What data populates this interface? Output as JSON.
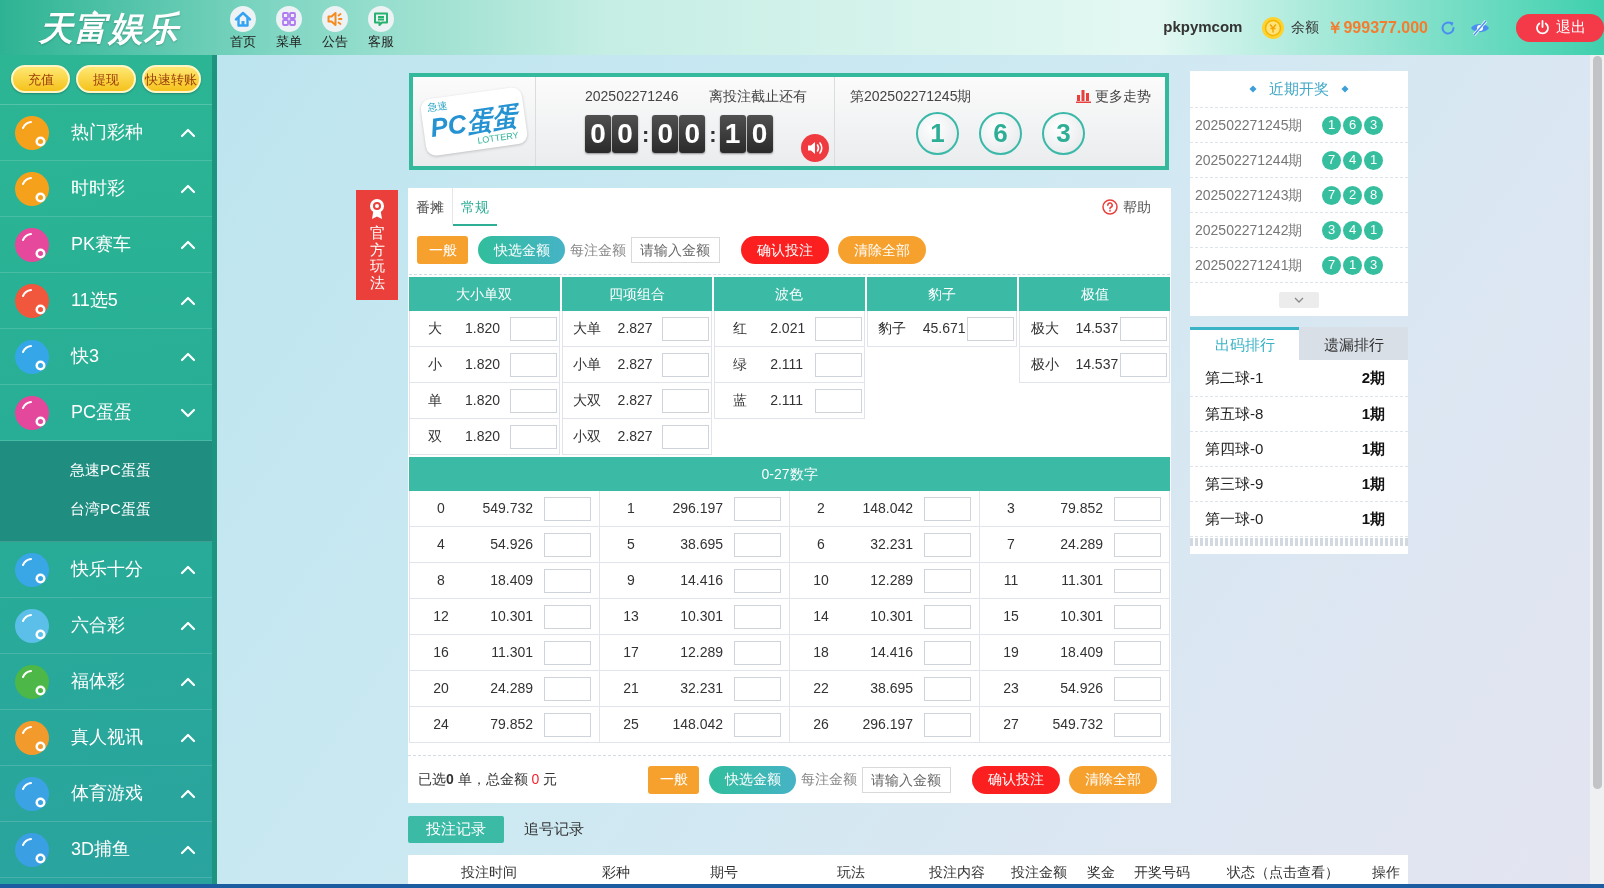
{
  "header": {
    "logo": "天富娱乐",
    "nav": [
      {
        "kind": "home",
        "label": "首页"
      },
      {
        "kind": "menu",
        "label": "菜单"
      },
      {
        "kind": "notice",
        "label": "公告"
      },
      {
        "kind": "service",
        "label": "客服"
      }
    ],
    "username": "pkpymcom",
    "balance_label": "余额",
    "balance": "￥999377.000",
    "logout": "退出"
  },
  "sidebar": {
    "actions": [
      "充值",
      "提现",
      "快速转账"
    ],
    "items": [
      {
        "label": "热门彩种",
        "color": "#f6a11c",
        "expanded": false
      },
      {
        "label": "时时彩",
        "color": "#f6a11c",
        "expanded": false
      },
      {
        "label": "PK赛车",
        "color": "#e6489b",
        "expanded": false
      },
      {
        "label": "11选5",
        "color": "#f0573c",
        "expanded": false
      },
      {
        "label": "快3",
        "color": "#35a7e8",
        "expanded": false
      },
      {
        "label": "PC蛋蛋",
        "color": "#e3489c",
        "expanded": true,
        "children": [
          {
            "label": "急速PC蛋蛋"
          },
          {
            "label": "台湾PC蛋蛋"
          }
        ]
      },
      {
        "label": "快乐十分",
        "color": "#39a6e6",
        "expanded": false
      },
      {
        "label": "六合彩",
        "color": "#5bbfe9",
        "expanded": false
      },
      {
        "label": "福体彩",
        "color": "#4db847",
        "expanded": false
      },
      {
        "label": "真人视讯",
        "color": "#f39a2c",
        "expanded": false
      },
      {
        "label": "体育游戏",
        "color": "#3ba2e4",
        "expanded": false
      },
      {
        "label": "3D捕鱼",
        "color": "#3aa0e3",
        "expanded": false
      }
    ]
  },
  "official_tab": "官方玩法",
  "draw_header": {
    "logo": {
      "badge": "急速",
      "title": "PC蛋蛋",
      "caption": "LOTTERY"
    },
    "current_issue": "202502271246",
    "countdown_label": "离投注截止还有",
    "countdown": [
      {
        "kind": "digit",
        "text": "0"
      },
      {
        "kind": "digit",
        "text": "0"
      },
      {
        "kind": "separator",
        "text": ":"
      },
      {
        "kind": "digit",
        "text": "0"
      },
      {
        "kind": "digit",
        "text": "0"
      },
      {
        "kind": "separator",
        "text": ":"
      },
      {
        "kind": "digit",
        "text": "1"
      },
      {
        "kind": "digit",
        "text": "0"
      }
    ],
    "last_issue": "第202502271245期",
    "trend_link": "更多走势",
    "results": [
      "1",
      "6",
      "3"
    ]
  },
  "bet_panel": {
    "tabs": [
      {
        "label": "番摊",
        "selected": false
      },
      {
        "label": "常规",
        "selected": true
      }
    ],
    "help": "帮助",
    "toolbar": {
      "mode_button": "一般",
      "quick_amount_button": "快选金额",
      "amount_label": "每注金额",
      "amount_placeholder": "请输入金额",
      "confirm_button": "确认投注",
      "clear_button": "清除全部"
    },
    "groups": [
      {
        "title": "大小单双",
        "options": [
          {
            "label": "大",
            "odds": "1.820"
          },
          {
            "label": "小",
            "odds": "1.820"
          },
          {
            "label": "单",
            "odds": "1.820"
          },
          {
            "label": "双",
            "odds": "1.820"
          }
        ]
      },
      {
        "title": "四项组合",
        "options": [
          {
            "label": "大单",
            "odds": "2.827"
          },
          {
            "label": "小单",
            "odds": "2.827"
          },
          {
            "label": "大双",
            "odds": "2.827"
          },
          {
            "label": "小双",
            "odds": "2.827"
          }
        ]
      },
      {
        "title": "波色",
        "options": [
          {
            "label": "红",
            "odds": "2.021"
          },
          {
            "label": "绿",
            "odds": "2.111"
          },
          {
            "label": "蓝",
            "odds": "2.111"
          }
        ]
      },
      {
        "title": "豹子",
        "options": [
          {
            "label": "豹子",
            "odds": "45.671"
          }
        ]
      },
      {
        "title": "极值",
        "options": [
          {
            "label": "极大",
            "odds": "14.537"
          },
          {
            "label": "极小",
            "odds": "14.537"
          }
        ]
      }
    ],
    "numbers": {
      "title": "0-27数字",
      "options": [
        {
          "label": "0",
          "odds": "549.732"
        },
        {
          "label": "1",
          "odds": "296.197"
        },
        {
          "label": "2",
          "odds": "148.042"
        },
        {
          "label": "3",
          "odds": "79.852"
        },
        {
          "label": "4",
          "odds": "54.926"
        },
        {
          "label": "5",
          "odds": "38.695"
        },
        {
          "label": "6",
          "odds": "32.231"
        },
        {
          "label": "7",
          "odds": "24.289"
        },
        {
          "label": "8",
          "odds": "18.409"
        },
        {
          "label": "9",
          "odds": "14.416"
        },
        {
          "label": "10",
          "odds": "12.289"
        },
        {
          "label": "11",
          "odds": "11.301"
        },
        {
          "label": "12",
          "odds": "10.301"
        },
        {
          "label": "13",
          "odds": "10.301"
        },
        {
          "label": "14",
          "odds": "10.301"
        },
        {
          "label": "15",
          "odds": "10.301"
        },
        {
          "label": "16",
          "odds": "11.301"
        },
        {
          "label": "17",
          "odds": "12.289"
        },
        {
          "label": "18",
          "odds": "14.416"
        },
        {
          "label": "19",
          "odds": "18.409"
        },
        {
          "label": "20",
          "odds": "24.289"
        },
        {
          "label": "21",
          "odds": "32.231"
        },
        {
          "label": "22",
          "odds": "38.695"
        },
        {
          "label": "23",
          "odds": "54.926"
        },
        {
          "label": "24",
          "odds": "79.852"
        },
        {
          "label": "25",
          "odds": "148.042"
        },
        {
          "label": "26",
          "odds": "296.197"
        },
        {
          "label": "27",
          "odds": "549.732"
        }
      ]
    },
    "footer": {
      "summary": {
        "prefix": "已选",
        "count": "0",
        "unit": "单，总金额",
        "amount": "0",
        "currency": "元"
      },
      "toolbar": {
        "mode_button": "一般",
        "quick_amount_button": "快选金额",
        "amount_label": "每注金额",
        "amount_placeholder": "请输入金额",
        "confirm_button": "确认投注",
        "clear_button": "清除全部"
      }
    }
  },
  "recent_draws": {
    "title": "近期开奖",
    "rows": [
      {
        "issue": "202502271245期",
        "numbers": [
          "1",
          "6",
          "3"
        ]
      },
      {
        "issue": "202502271244期",
        "numbers": [
          "7",
          "4",
          "1"
        ]
      },
      {
        "issue": "202502271243期",
        "numbers": [
          "7",
          "2",
          "8"
        ]
      },
      {
        "issue": "202502271242期",
        "numbers": [
          "3",
          "4",
          "1"
        ]
      },
      {
        "issue": "202502271241期",
        "numbers": [
          "7",
          "1",
          "3"
        ]
      }
    ]
  },
  "ranking": {
    "tabs": [
      {
        "label": "出码排行",
        "selected": true
      },
      {
        "label": "遗漏排行",
        "selected": false
      }
    ],
    "rows": [
      {
        "label": "第二球-1",
        "value": "2期"
      },
      {
        "label": "第五球-8",
        "value": "1期"
      },
      {
        "label": "第四球-0",
        "value": "1期"
      },
      {
        "label": "第三球-9",
        "value": "1期"
      },
      {
        "label": "第一球-0",
        "value": "1期"
      }
    ]
  },
  "records": {
    "tabs": [
      {
        "label": "投注记录",
        "selected": true
      },
      {
        "label": "追号记录",
        "selected": false
      }
    ],
    "columns": [
      "投注时间",
      "彩种",
      "期号",
      "玩法",
      "投注内容",
      "投注金额",
      "奖金",
      "开奖号码",
      "状态（点击查看）",
      "操作"
    ]
  }
}
